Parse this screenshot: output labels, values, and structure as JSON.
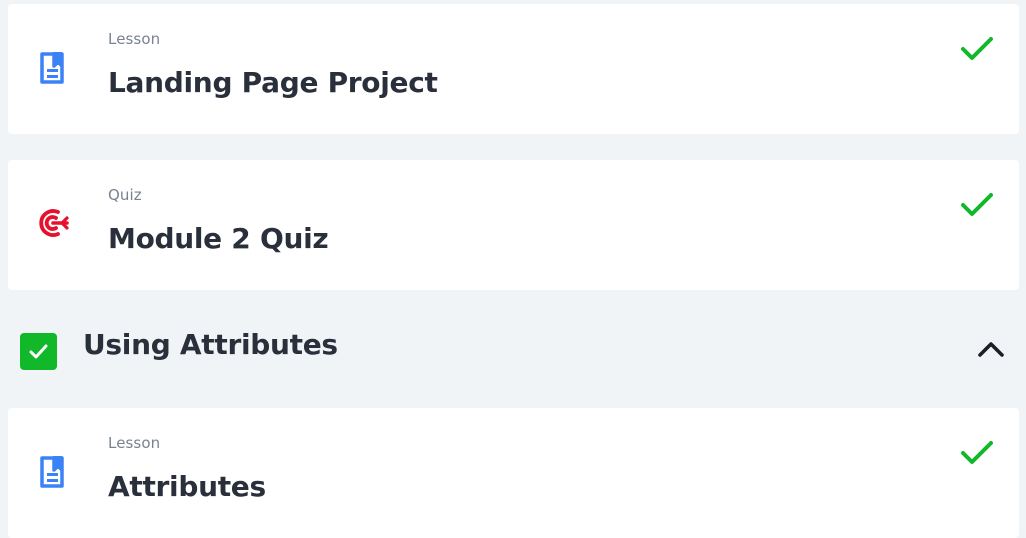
{
  "items": [
    {
      "type": "Lesson",
      "title": "Landing Page Project",
      "icon": "lesson-doc-icon",
      "status": "complete"
    },
    {
      "type": "Quiz",
      "title": "Module 2 Quiz",
      "icon": "target-icon",
      "status": "complete"
    },
    {
      "type": "Lesson",
      "title": "Attributes",
      "icon": "lesson-doc-icon",
      "status": "complete"
    }
  ],
  "section": {
    "title": "Using Attributes",
    "status": "complete",
    "expanded": true
  },
  "colors": {
    "lesson_icon": "#3b82f6",
    "quiz_icon": "#e8112d",
    "check": "#11b82a",
    "background": "#f1f4f7",
    "card": "#ffffff",
    "title_text": "#2a303b",
    "type_text": "#7a8190"
  }
}
